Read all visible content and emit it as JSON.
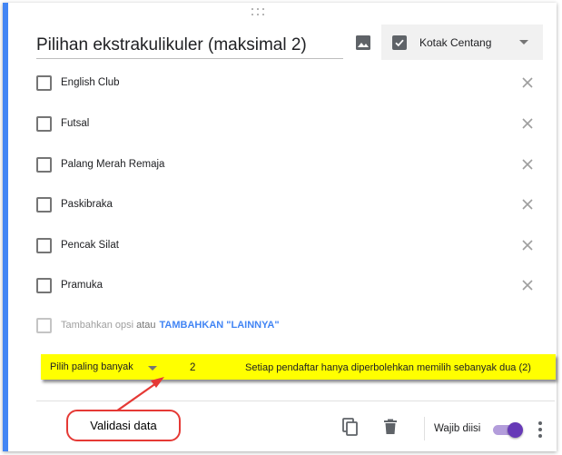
{
  "question": {
    "title": "Pilihan ekstrakulikuler (maksimal 2)",
    "type_label": "Kotak Centang"
  },
  "options": [
    {
      "label": "English Club"
    },
    {
      "label": "Futsal"
    },
    {
      "label": "Palang Merah Remaja"
    },
    {
      "label": "Paskibraka"
    },
    {
      "label": "Pencak Silat"
    },
    {
      "label": "Pramuka"
    }
  ],
  "add_option": {
    "add_text": "Tambahkan opsi",
    "or_text": "atau",
    "add_other_link": "TAMBAHKAN \"LAINNYA\""
  },
  "validation": {
    "rule": "Pilih paling banyak",
    "number": "2",
    "error_message": "Setiap pendaftar hanya diperbolehkan memilih sebanyak  dua (2)"
  },
  "annotation": {
    "label": "Validasi data",
    "color": "#e53935"
  },
  "footer": {
    "required_label": "Wajib diisi",
    "required_on": true
  },
  "colors": {
    "accent": "#4285f4",
    "toggle": "#673ab7",
    "highlight": "#ffff00"
  }
}
